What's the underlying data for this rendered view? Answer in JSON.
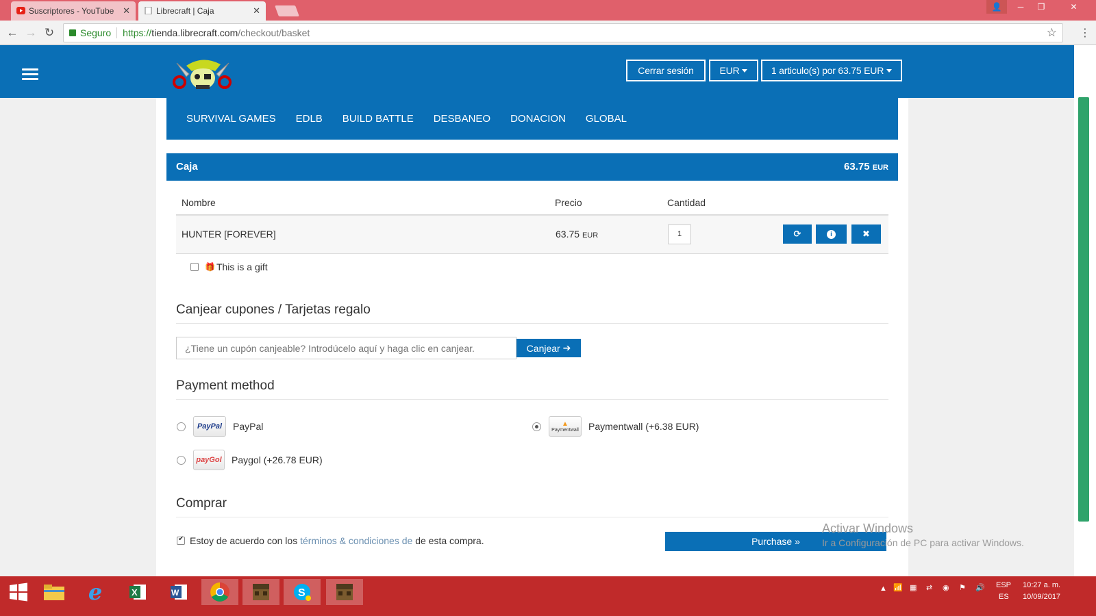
{
  "browser": {
    "tabs": [
      {
        "label": "Suscriptores - YouTube"
      },
      {
        "label": "Librecraft | Caja"
      }
    ],
    "secure_label": "Seguro",
    "url_proto": "https://",
    "url_host": "tienda.librecraft.com",
    "url_path": "/checkout/basket"
  },
  "header": {
    "logout_label": "Cerrar sesión",
    "currency_label": "EUR",
    "cart_label": "1 articulo(s) por 63.75 EUR"
  },
  "nav": {
    "items": [
      {
        "label": "SURVIVAL GAMES"
      },
      {
        "label": "EDLB"
      },
      {
        "label": "BUILD BATTLE"
      },
      {
        "label": "DESBANEO"
      },
      {
        "label": "DONACION"
      },
      {
        "label": "GLOBAL"
      }
    ]
  },
  "basket": {
    "title": "Caja",
    "total_value": "63.75",
    "total_currency": "EUR",
    "columns": {
      "name": "Nombre",
      "price": "Precio",
      "quantity": "Cantidad"
    },
    "items": [
      {
        "name": "HUNTER [FOREVER]",
        "price": "63.75",
        "currency": "EUR",
        "quantity": "1"
      }
    ],
    "gift_label": "This is a gift"
  },
  "coupon": {
    "title": "Canjear cupones / Tarjetas regalo",
    "placeholder": "¿Tiene un cupón canjeable? Introdúcelo aquí y haga clic en canjear.",
    "button_label": "Canjear"
  },
  "payment": {
    "title": "Payment method",
    "methods": [
      {
        "name": "PayPal",
        "fee": "",
        "logo_text": "PayPal",
        "selected": false
      },
      {
        "name": "Paymentwall",
        "fee": "(+6.38 EUR)",
        "logo_text": "Paymentwall",
        "selected": true
      },
      {
        "name": "Paygol",
        "fee": "(+26.78 EUR)",
        "logo_text": "payGol",
        "selected": false
      }
    ]
  },
  "purchase": {
    "title": "Comprar",
    "agree_prefix": "Estoy de acuerdo con los",
    "agree_link": "términos & condiciones de",
    "agree_suffix": "de esta compra.",
    "button_label": "Purchase »"
  },
  "watermark": {
    "line1": "Activar Windows",
    "line2": "Ir a Configuración de PC para activar Windows."
  },
  "tray": {
    "lang_line1": "ESP",
    "lang_line2": "ES",
    "time": "10:27 a. m.",
    "date": "10/09/2017"
  },
  "colors": {
    "brand_blue": "#0a6fb6",
    "taskbar_red": "#c02a2a",
    "chrome_tabbar": "#e0606b"
  }
}
